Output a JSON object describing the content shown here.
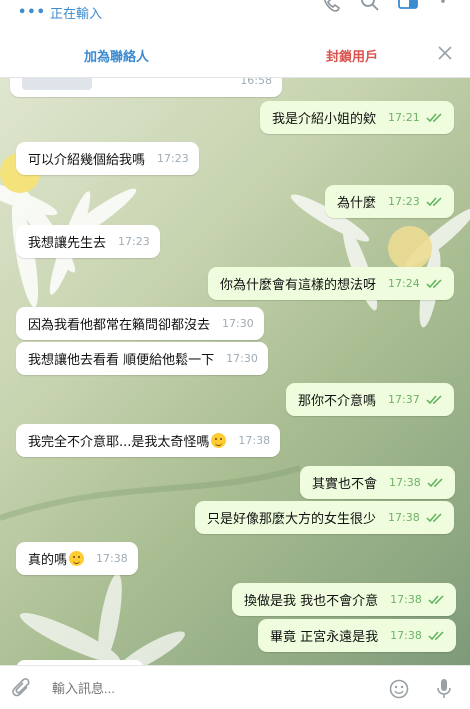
{
  "header": {
    "status": "正在輸入",
    "status_dots": "•••"
  },
  "actions": {
    "add_contact": "加為聯絡人",
    "block_user": "封鎖用戶"
  },
  "colors": {
    "accent_blue": "#3a8bd1",
    "block_red": "#d9534f",
    "bubble_out": "#effdde",
    "bubble_in": "#ffffff",
    "time_out": "#6fb26a"
  },
  "messages": [
    {
      "dir": "in",
      "text": "",
      "time": "16:58"
    },
    {
      "dir": "out",
      "text": "我是介紹小姐的欸",
      "time": "17:21"
    },
    {
      "dir": "in",
      "text": "可以介紹幾個給我嗎",
      "time": "17:23"
    },
    {
      "dir": "out",
      "text": "為什麼",
      "time": "17:23"
    },
    {
      "dir": "in",
      "text": "我想讓先生去",
      "time": "17:23"
    },
    {
      "dir": "out",
      "text": "你為什麼會有這樣的想法呀",
      "time": "17:24"
    },
    {
      "dir": "in",
      "text": "因為我看他都常在籟問卻都沒去",
      "time": "17:30"
    },
    {
      "dir": "in",
      "text": "我想讓他去看看 順便給他鬆一下",
      "time": "17:30"
    },
    {
      "dir": "out",
      "text": "那你不介意嗎",
      "time": "17:37"
    },
    {
      "dir": "in",
      "text": "我完全不介意耶...是我太奇怪嗎",
      "time": "17:38",
      "emoji": "worried"
    },
    {
      "dir": "out",
      "text": "其實也不會",
      "time": "17:38"
    },
    {
      "dir": "out",
      "text": "只是好像那麼大方的女生很少",
      "time": "17:38"
    },
    {
      "dir": "in",
      "text": "真的嗎",
      "time": "17:38",
      "emoji": "laughing"
    },
    {
      "dir": "out",
      "text": "換做是我 我也不會介意",
      "time": "17:38"
    },
    {
      "dir": "out",
      "text": "畢竟 正宮永遠是我",
      "time": "17:38"
    }
  ],
  "composer": {
    "placeholder": "輸入訊息..."
  },
  "icons": {
    "call": "phone-icon",
    "search": "search-icon",
    "sidebar": "sidebar-icon",
    "more": "more-vertical-icon",
    "close": "close-icon",
    "attach": "paperclip-icon",
    "emoji": "smiley-icon",
    "mic": "microphone-icon"
  }
}
